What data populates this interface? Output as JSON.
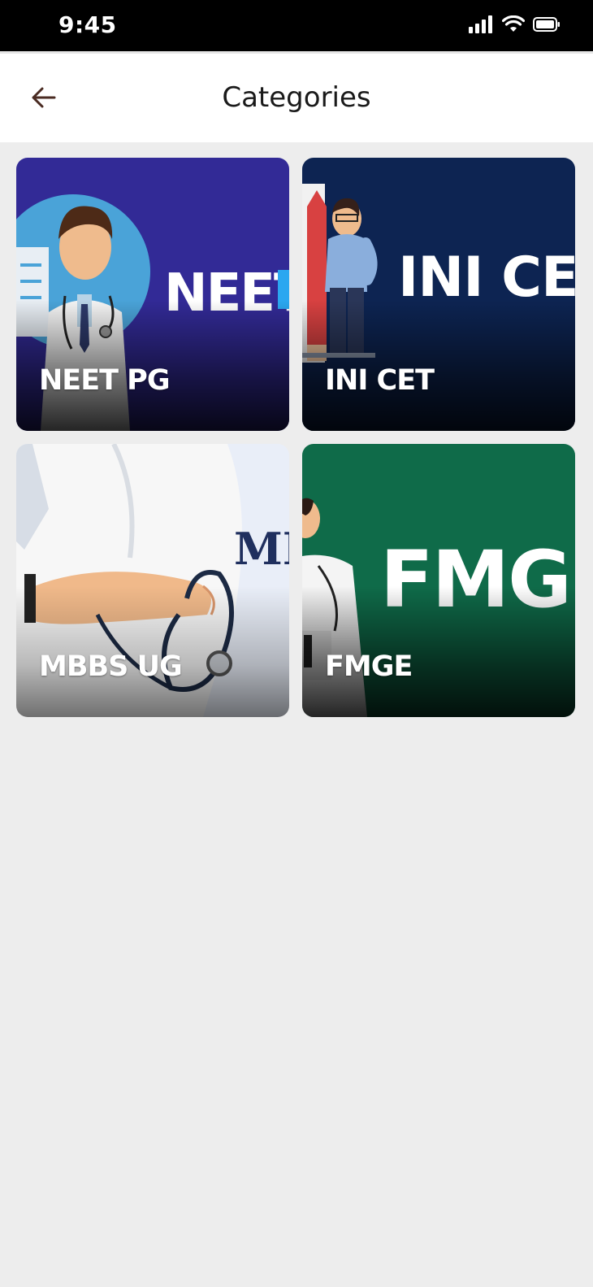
{
  "status_bar": {
    "time": "9:45"
  },
  "header": {
    "title": "Categories",
    "back_icon": "arrow-left-icon"
  },
  "categories": [
    {
      "label": "NEET PG",
      "banner_text": "NEET P",
      "bg_color": "#322a96"
    },
    {
      "label": "INI CET",
      "banner_text": "INI CE",
      "bg_color": "#0d2452"
    },
    {
      "label": "MBBS UG",
      "banner_text": "MI",
      "bg_color": "#e9eef8"
    },
    {
      "label": "FMGE",
      "banner_text": "FMG",
      "bg_color": "#0f6b49"
    }
  ]
}
